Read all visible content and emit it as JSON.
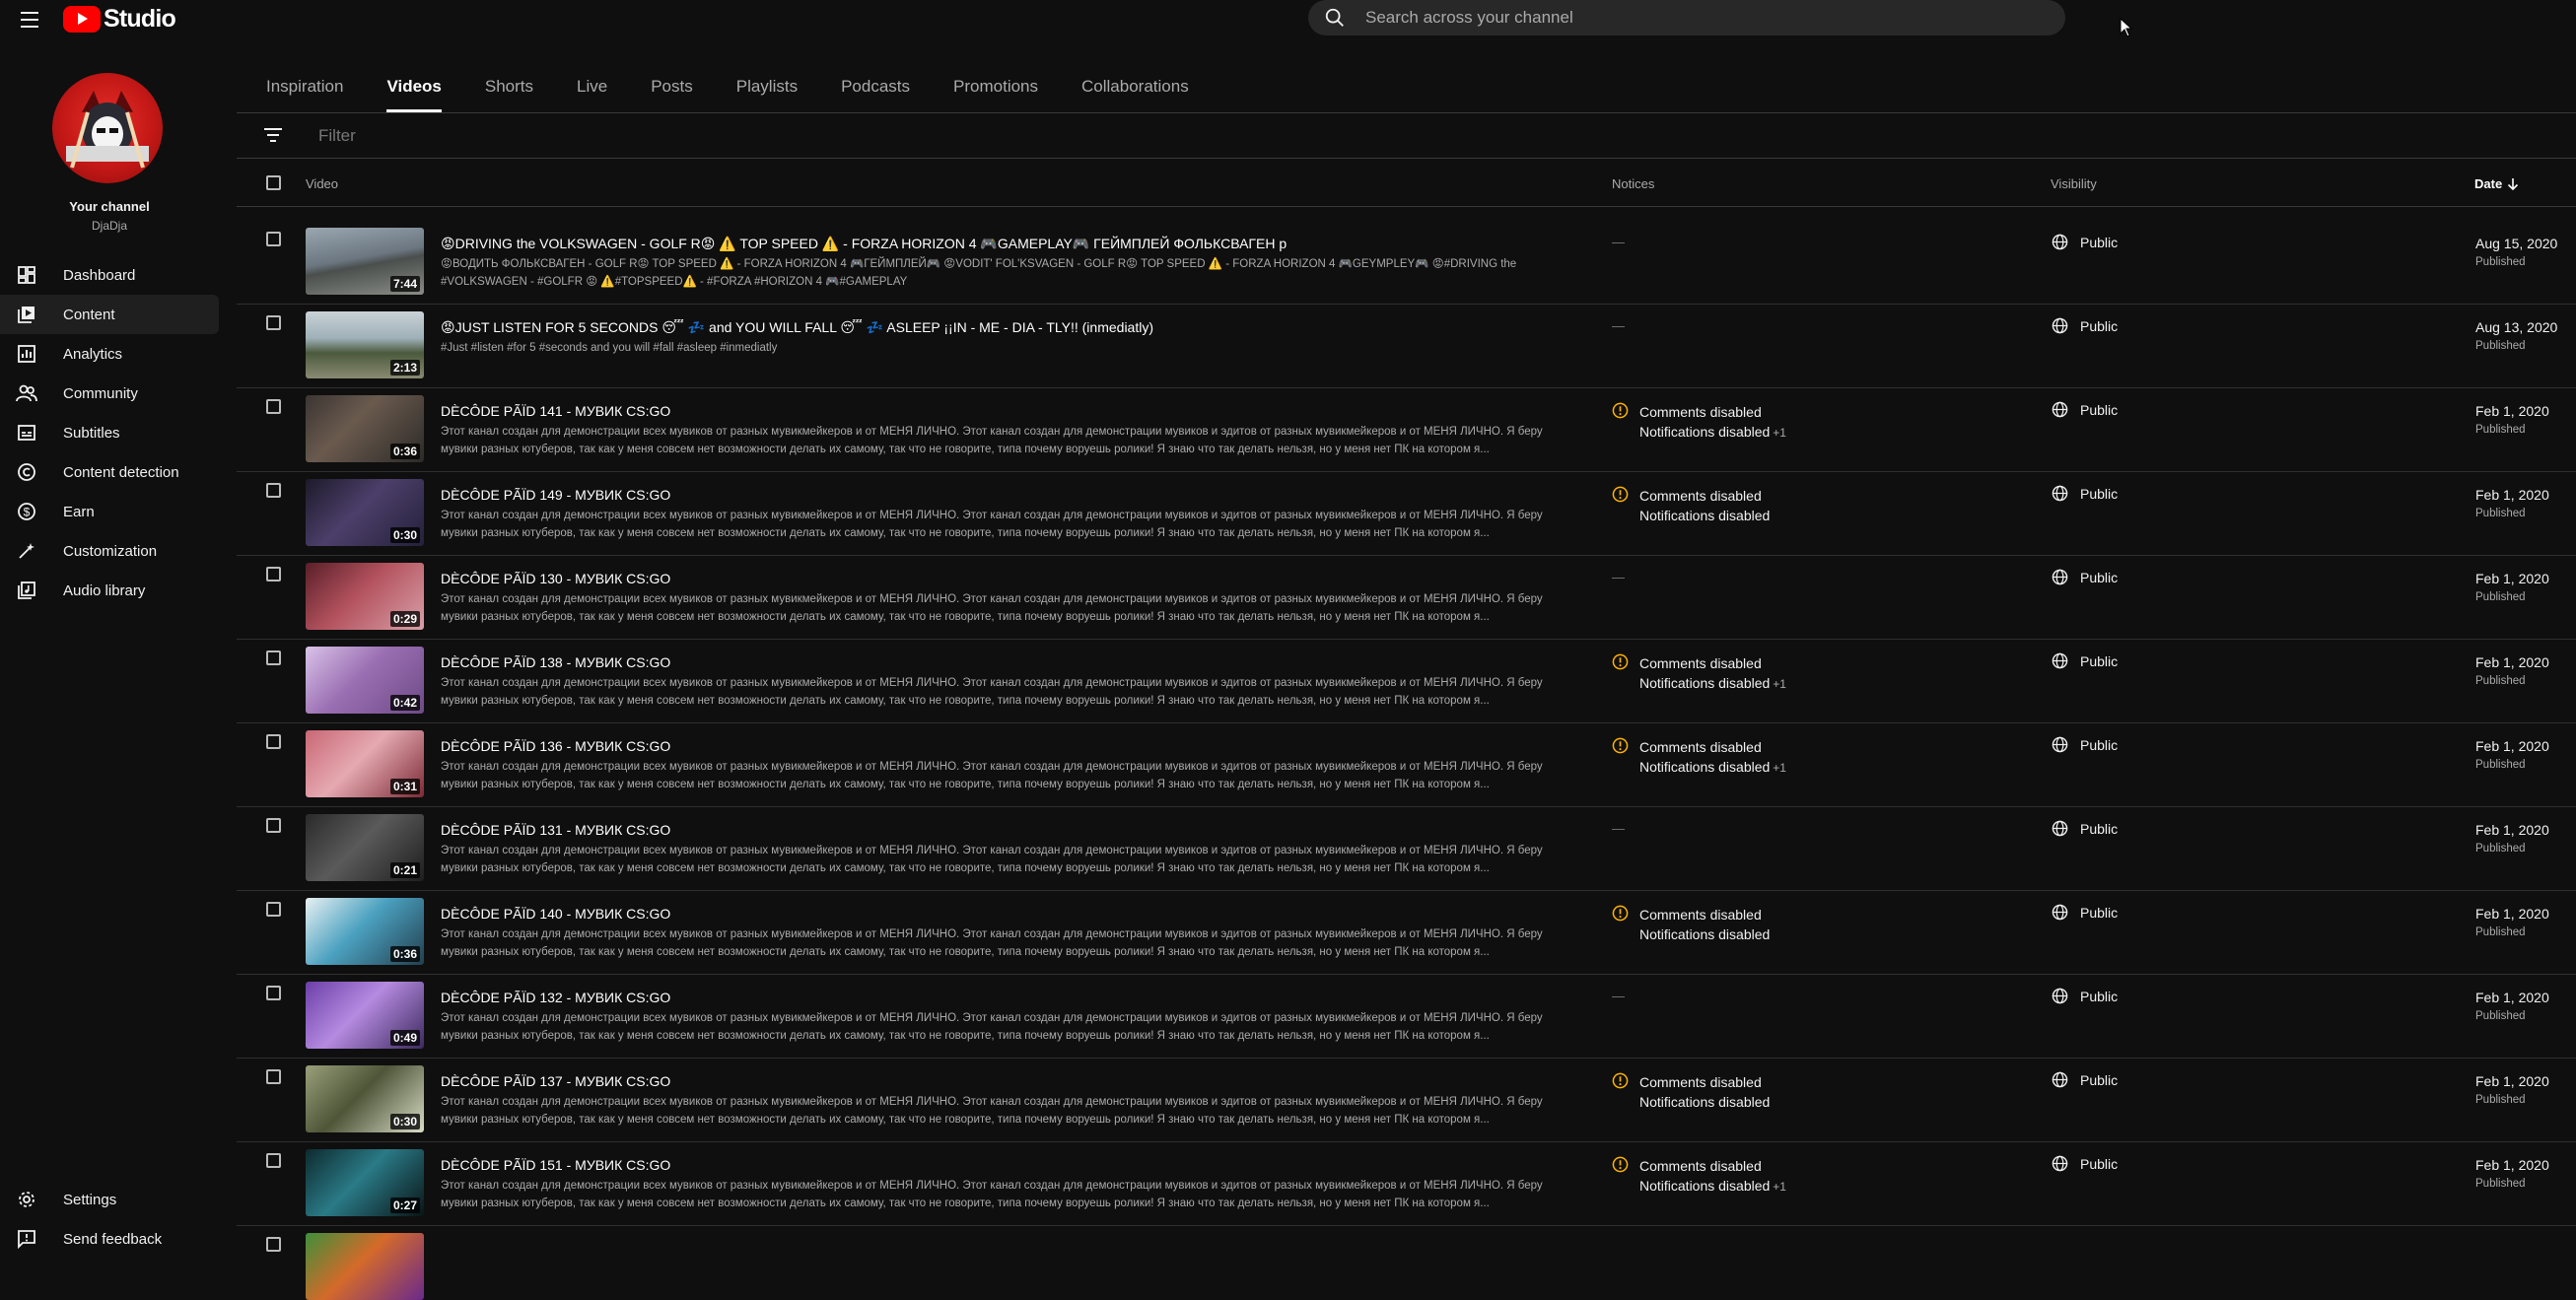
{
  "header": {
    "app_name": "Studio",
    "search_placeholder": "Search across your channel"
  },
  "sidebar": {
    "channel_label": "Your channel",
    "channel_name": "DjaDja",
    "items": [
      {
        "label": "Dashboard",
        "icon": "dashboard-icon"
      },
      {
        "label": "Content",
        "icon": "content-icon",
        "active": true
      },
      {
        "label": "Analytics",
        "icon": "analytics-icon"
      },
      {
        "label": "Community",
        "icon": "community-icon"
      },
      {
        "label": "Subtitles",
        "icon": "subtitles-icon"
      },
      {
        "label": "Content detection",
        "icon": "copyright-icon"
      },
      {
        "label": "Earn",
        "icon": "dollar-icon"
      },
      {
        "label": "Customization",
        "icon": "magic-wand-icon"
      },
      {
        "label": "Audio library",
        "icon": "audio-library-icon"
      }
    ],
    "bottom_items": [
      {
        "label": "Settings",
        "icon": "gear-icon"
      },
      {
        "label": "Send feedback",
        "icon": "feedback-icon"
      }
    ]
  },
  "tabs": [
    "Inspiration",
    "Videos",
    "Shorts",
    "Live",
    "Posts",
    "Playlists",
    "Podcasts",
    "Promotions",
    "Collaborations"
  ],
  "active_tab": "Videos",
  "filter_placeholder": "Filter",
  "table": {
    "columns": {
      "video": "Video",
      "notices": "Notices",
      "visibility": "Visibility",
      "date": "Date"
    },
    "rows": [
      {
        "title": "😡DRIVING the VOLKSWAGEN - GOLF R😡 ⚠️ TOP SPEED ⚠️ - FORZA HORIZON 4 🎮GAMEPLAY🎮 ГЕЙМПЛЕЙ ФОЛЬКСВАГЕН р",
        "description": "😡ВОДИТЬ ФОЛЬКСВАГЕН - GOLF R😡 TOP SPEED ⚠️ - FORZA HORIZON 4 🎮ГЕЙМПЛЕЙ🎮 😡VODIT' FOL'KSVAGEN - GOLF R😡 TOP SPEED ⚠️ - FORZA HORIZON 4 🎮GEYMPLEY🎮 😡#DRIVING the #VOLKSWAGEN - #GOLFR 😡 ⚠️#TOPSPEED⚠️ - #FORZA #HORIZON 4 🎮#GAMEPLAY",
        "duration": "7:44",
        "notice1": "—",
        "notice2": "",
        "notice_more": "",
        "visibility": "Public",
        "date": "Aug 15, 2020",
        "status": "Published"
      },
      {
        "title": "😡JUST LISTEN FOR 5 SECONDS 😴 💤 and YOU WILL FALL 😴 💤 ASLEEP ¡¡IN - ME - DIA - TLY!! (inmediatly)",
        "description": "#Just #listen #for 5 #seconds and you will #fall #asleep #inmediatly",
        "duration": "2:13",
        "notice1": "—",
        "notice2": "",
        "notice_more": "",
        "visibility": "Public",
        "date": "Aug 13, 2020",
        "status": "Published"
      },
      {
        "title": "DÈCÔDE PÃÏD 141 - МУВИК CS:GO",
        "description": "Этот канал создан для демонстрации всех мувиков от разных мувикмейкеров и от МЕНЯ ЛИЧНО. Этот канал создан для демонстрации мувиков и эдитов от разных мувикмейкеров и от МЕНЯ ЛИЧНО. Я беру мувики разных ютуберов, так как у меня совсем нет возможности делать их самому, так что не говорите, типа почему воруешь ролики! Я знаю что так делать нельзя, но у меня нет ПК на котором я...",
        "duration": "0:36",
        "notice1": "Comments disabled",
        "notice2": "Notifications disabled",
        "notice_more": "+1",
        "visibility": "Public",
        "date": "Feb 1, 2020",
        "status": "Published"
      },
      {
        "title": "DÈCÔDE PÃÏD 149 - МУВИК CS:GO",
        "description": "Этот канал создан для демонстрации всех мувиков от разных мувикмейкеров и от МЕНЯ ЛИЧНО. Этот канал создан для демонстрации мувиков и эдитов от разных мувикмейкеров и от МЕНЯ ЛИЧНО. Я беру мувики разных ютуберов, так как у меня совсем нет возможности делать их самому, так что не говорите, типа почему воруешь ролики! Я знаю что так делать нельзя, но у меня нет ПК на котором я...",
        "duration": "0:30",
        "notice1": "Comments disabled",
        "notice2": "Notifications disabled",
        "notice_more": "",
        "visibility": "Public",
        "date": "Feb 1, 2020",
        "status": "Published"
      },
      {
        "title": "DÈCÔDE PÃÏD 130 - МУВИК CS:GO",
        "description": "Этот канал создан для демонстрации всех мувиков от разных мувикмейкеров и от МЕНЯ ЛИЧНО. Этот канал создан для демонстрации мувиков и эдитов от разных мувикмейкеров и от МЕНЯ ЛИЧНО. Я беру мувики разных ютуберов, так как у меня совсем нет возможности делать их самому, так что не говорите, типа почему воруешь ролики! Я знаю что так делать нельзя, но у меня нет ПК на котором я...",
        "duration": "0:29",
        "notice1": "—",
        "notice2": "",
        "notice_more": "",
        "visibility": "Public",
        "date": "Feb 1, 2020",
        "status": "Published"
      },
      {
        "title": "DÈCÔDE PÃÏD 138 - МУВИК CS:GO",
        "description": "Этот канал создан для демонстрации всех мувиков от разных мувикмейкеров и от МЕНЯ ЛИЧНО. Этот канал создан для демонстрации мувиков и эдитов от разных мувикмейкеров и от МЕНЯ ЛИЧНО. Я беру мувики разных ютуберов, так как у меня совсем нет возможности делать их самому, так что не говорите, типа почему воруешь ролики! Я знаю что так делать нельзя, но у меня нет ПК на котором я...",
        "duration": "0:42",
        "notice1": "Comments disabled",
        "notice2": "Notifications disabled",
        "notice_more": "+1",
        "visibility": "Public",
        "date": "Feb 1, 2020",
        "status": "Published"
      },
      {
        "title": "DÈCÔDE PÃÏD 136 - МУВИК CS:GO",
        "description": "Этот канал создан для демонстрации всех мувиков от разных мувикмейкеров и от МЕНЯ ЛИЧНО. Этот канал создан для демонстрации мувиков и эдитов от разных мувикмейкеров и от МЕНЯ ЛИЧНО. Я беру мувики разных ютуберов, так как у меня совсем нет возможности делать их самому, так что не говорите, типа почему воруешь ролики! Я знаю что так делать нельзя, но у меня нет ПК на котором я...",
        "duration": "0:31",
        "notice1": "Comments disabled",
        "notice2": "Notifications disabled",
        "notice_more": "+1",
        "visibility": "Public",
        "date": "Feb 1, 2020",
        "status": "Published"
      },
      {
        "title": "DÈCÔDE PÃÏD 131 - МУВИК CS:GO",
        "description": "Этот канал создан для демонстрации всех мувиков от разных мувикмейкеров и от МЕНЯ ЛИЧНО. Этот канал создан для демонстрации мувиков и эдитов от разных мувикмейкеров и от МЕНЯ ЛИЧНО. Я беру мувики разных ютуберов, так как у меня совсем нет возможности делать их самому, так что не говорите, типа почему воруешь ролики! Я знаю что так делать нельзя, но у меня нет ПК на котором я...",
        "duration": "0:21",
        "notice1": "—",
        "notice2": "",
        "notice_more": "",
        "visibility": "Public",
        "date": "Feb 1, 2020",
        "status": "Published"
      },
      {
        "title": "DÈCÔDE PÃÏD 140 - МУВИК CS:GO",
        "description": "Этот канал создан для демонстрации всех мувиков от разных мувикмейкеров и от МЕНЯ ЛИЧНО. Этот канал создан для демонстрации мувиков и эдитов от разных мувикмейкеров и от МЕНЯ ЛИЧНО. Я беру мувики разных ютуберов, так как у меня совсем нет возможности делать их самому, так что не говорите, типа почему воруешь ролики! Я знаю что так делать нельзя, но у меня нет ПК на котором я...",
        "duration": "0:36",
        "notice1": "Comments disabled",
        "notice2": "Notifications disabled",
        "notice_more": "",
        "visibility": "Public",
        "date": "Feb 1, 2020",
        "status": "Published"
      },
      {
        "title": "DÈCÔDE PÃÏD 132 - МУВИК CS:GO",
        "description": "Этот канал создан для демонстрации всех мувиков от разных мувикмейкеров и от МЕНЯ ЛИЧНО. Этот канал создан для демонстрации мувиков и эдитов от разных мувикмейкеров и от МЕНЯ ЛИЧНО. Я беру мувики разных ютуберов, так как у меня совсем нет возможности делать их самому, так что не говорите, типа почему воруешь ролики! Я знаю что так делать нельзя, но у меня нет ПК на котором я...",
        "duration": "0:49",
        "notice1": "—",
        "notice2": "",
        "notice_more": "",
        "visibility": "Public",
        "date": "Feb 1, 2020",
        "status": "Published"
      },
      {
        "title": "DÈCÔDE PÃÏD 137 - МУВИК CS:GO",
        "description": "Этот канал создан для демонстрации всех мувиков от разных мувикмейкеров и от МЕНЯ ЛИЧНО. Этот канал создан для демонстрации мувиков и эдитов от разных мувикмейкеров и от МЕНЯ ЛИЧНО. Я беру мувики разных ютуберов, так как у меня совсем нет возможности делать их самому, так что не говорите, типа почему воруешь ролики! Я знаю что так делать нельзя, но у меня нет ПК на котором я...",
        "duration": "0:30",
        "notice1": "Comments disabled",
        "notice2": "Notifications disabled",
        "notice_more": "",
        "visibility": "Public",
        "date": "Feb 1, 2020",
        "status": "Published"
      },
      {
        "title": "DÈCÔDE PÃÏD 151 - МУВИК CS:GO",
        "description": "Этот канал создан для демонстрации всех мувиков от разных мувикмейкеров и от МЕНЯ ЛИЧНО. Этот канал создан для демонстрации мувиков и эдитов от разных мувикмейкеров и от МЕНЯ ЛИЧНО. Я беру мувики разных ютуберов, так как у меня совсем нет возможности делать их самому, так что не говорите, типа почему воруешь ролики! Я знаю что так делать нельзя, но у меня нет ПК на котором я...",
        "duration": "0:27",
        "notice1": "Comments disabled",
        "notice2": "Notifications disabled",
        "notice_more": "+1",
        "visibility": "Public",
        "date": "Feb 1, 2020",
        "status": "Published"
      }
    ]
  }
}
